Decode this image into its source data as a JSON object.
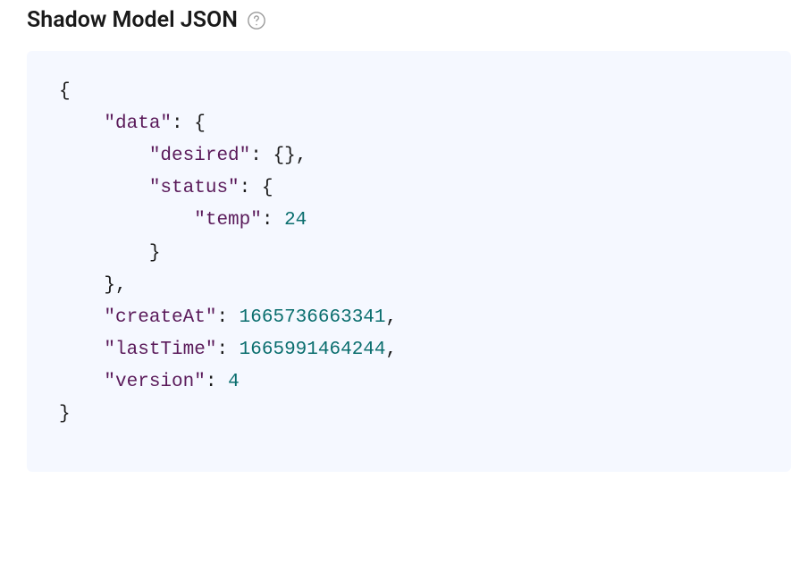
{
  "header": {
    "title": "Shadow Model JSON"
  },
  "code": {
    "line1_brace": "{",
    "line2_indent": "    ",
    "line2_key": "\"data\"",
    "line2_colon": ": ",
    "line2_brace": "{",
    "line3_indent": "        ",
    "line3_key": "\"desired\"",
    "line3_colon": ": ",
    "line3_val": "{}",
    "line3_comma": ",",
    "line4_indent": "        ",
    "line4_key": "\"status\"",
    "line4_colon": ": ",
    "line4_brace": "{",
    "line5_indent": "            ",
    "line5_key": "\"temp\"",
    "line5_colon": ": ",
    "line5_val": "24",
    "line6_indent": "        ",
    "line6_brace": "}",
    "line7_indent": "    ",
    "line7_brace": "}",
    "line7_comma": ",",
    "line8_indent": "    ",
    "line8_key": "\"createAt\"",
    "line8_colon": ": ",
    "line8_val": "1665736663341",
    "line8_comma": ",",
    "line9_indent": "    ",
    "line9_key": "\"lastTime\"",
    "line9_colon": ": ",
    "line9_val": "1665991464244",
    "line9_comma": ",",
    "line10_indent": "    ",
    "line10_key": "\"version\"",
    "line10_colon": ": ",
    "line10_val": "4",
    "line11_brace": "}"
  }
}
